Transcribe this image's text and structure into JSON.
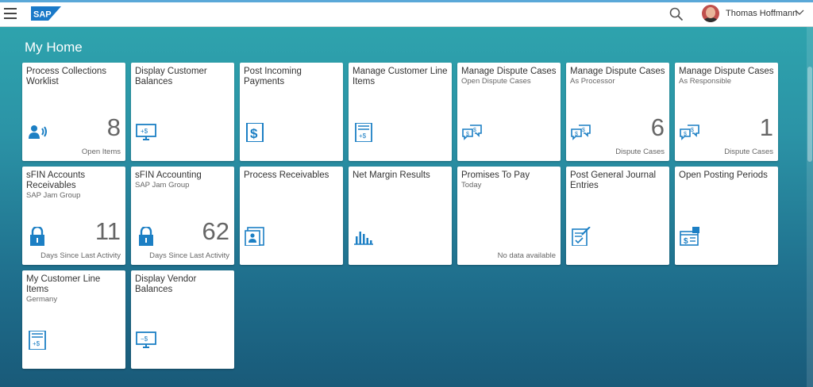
{
  "header": {
    "user_name": "Thomas Hoffmann",
    "logo_text": "SAP"
  },
  "page": {
    "title": "My Home"
  },
  "tiles": [
    {
      "title": "Process Collections Worklist",
      "subtitle": "",
      "number": "8",
      "footer": "Open Items",
      "icon": "collections-icon"
    },
    {
      "title": "Display Customer Balances",
      "subtitle": "",
      "number": "",
      "footer": "",
      "icon": "monitor-plus-dollar-icon"
    },
    {
      "title": "Post Incoming Payments",
      "subtitle": "",
      "number": "",
      "footer": "",
      "icon": "dollar-document-icon"
    },
    {
      "title": "Manage Customer Line Items",
      "subtitle": "",
      "number": "",
      "footer": "",
      "icon": "line-items-icon"
    },
    {
      "title": "Manage Dispute Cases",
      "subtitle": "Open Dispute Cases",
      "number": "",
      "footer": "",
      "icon": "dispute-chat-icon"
    },
    {
      "title": "Manage Dispute Cases",
      "subtitle": "As Processor",
      "number": "6",
      "footer": "Dispute Cases",
      "icon": "dispute-chat-icon"
    },
    {
      "title": "Manage Dispute Cases",
      "subtitle": "As Responsible",
      "number": "1",
      "footer": "Dispute Cases",
      "icon": "dispute-chat-icon"
    },
    {
      "title": "sFIN Accounts Receivables",
      "subtitle": "SAP Jam Group",
      "number": "11",
      "footer": "Days Since Last Activity",
      "icon": "lock-icon"
    },
    {
      "title": "sFIN Accounting",
      "subtitle": "SAP Jam Group",
      "number": "62",
      "footer": "Days Since Last Activity",
      "icon": "lock-icon"
    },
    {
      "title": "Process Receivables",
      "subtitle": "",
      "number": "",
      "footer": "",
      "icon": "receivables-icon"
    },
    {
      "title": "Net Margin Results",
      "subtitle": "",
      "number": "",
      "footer": "",
      "icon": "bar-chart-icon"
    },
    {
      "title": "Promises To Pay",
      "subtitle": "Today",
      "number": "",
      "footer": "No data available",
      "icon": ""
    },
    {
      "title": "Post General Journal Entries",
      "subtitle": "",
      "number": "",
      "footer": "",
      "icon": "journal-entry-icon"
    },
    {
      "title": "Open Posting Periods",
      "subtitle": "",
      "number": "",
      "footer": "",
      "icon": "posting-periods-icon"
    },
    {
      "title": "My Customer Line Items",
      "subtitle": "Germany",
      "number": "",
      "footer": "",
      "icon": "line-items-icon"
    },
    {
      "title": "Display Vendor Balances",
      "subtitle": "",
      "number": "",
      "footer": "",
      "icon": "monitor-minus-dollar-icon"
    }
  ],
  "colors": {
    "accent": "#0a6ed1",
    "icon": "#1c7fc4",
    "background_top": "#2ea3ad",
    "background_bottom": "#195a79"
  }
}
